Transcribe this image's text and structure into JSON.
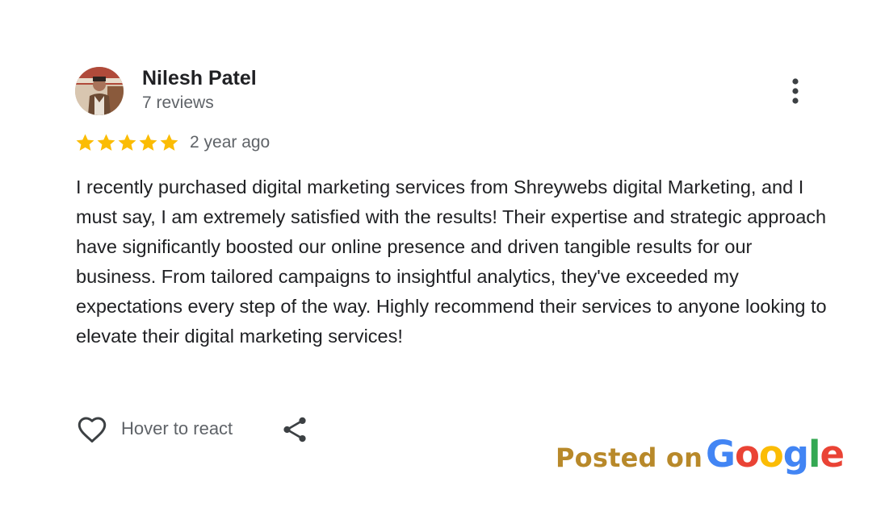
{
  "review": {
    "reviewer": {
      "name": "Nilesh Patel",
      "review_count": "7 reviews",
      "avatar_icon": "profile-photo"
    },
    "rating": 5,
    "rating_max": 5,
    "star_color": "#FBBC04",
    "date": "2 year ago",
    "text": "I recently purchased digital marketing services from Shreywebs digital Marketing, and I must say, I am extremely satisfied with the results! Their expertise and strategic approach have significantly boosted our online presence and driven tangible results for our business. From tailored campaigns to insightful analytics, they've exceeded my expectations every step of the way. Highly recommend their services to anyone looking to elevate their digital marketing services!",
    "actions": {
      "react_label": "Hover to react",
      "like_icon": "heart-outline-icon",
      "share_icon": "share-icon",
      "more_icon": "more-vertical-icon"
    }
  },
  "footer": {
    "posted_on": "Posted on",
    "brand": {
      "letters": [
        "G",
        "o",
        "o",
        "g",
        "l",
        "e"
      ],
      "colors": [
        "#4285F4",
        "#EA4335",
        "#FBBC05",
        "#4285F4",
        "#34A853",
        "#EA4335"
      ]
    }
  },
  "colors": {
    "text_primary": "#202124",
    "text_secondary": "#5f6368",
    "posted_on": "#b8892a"
  }
}
